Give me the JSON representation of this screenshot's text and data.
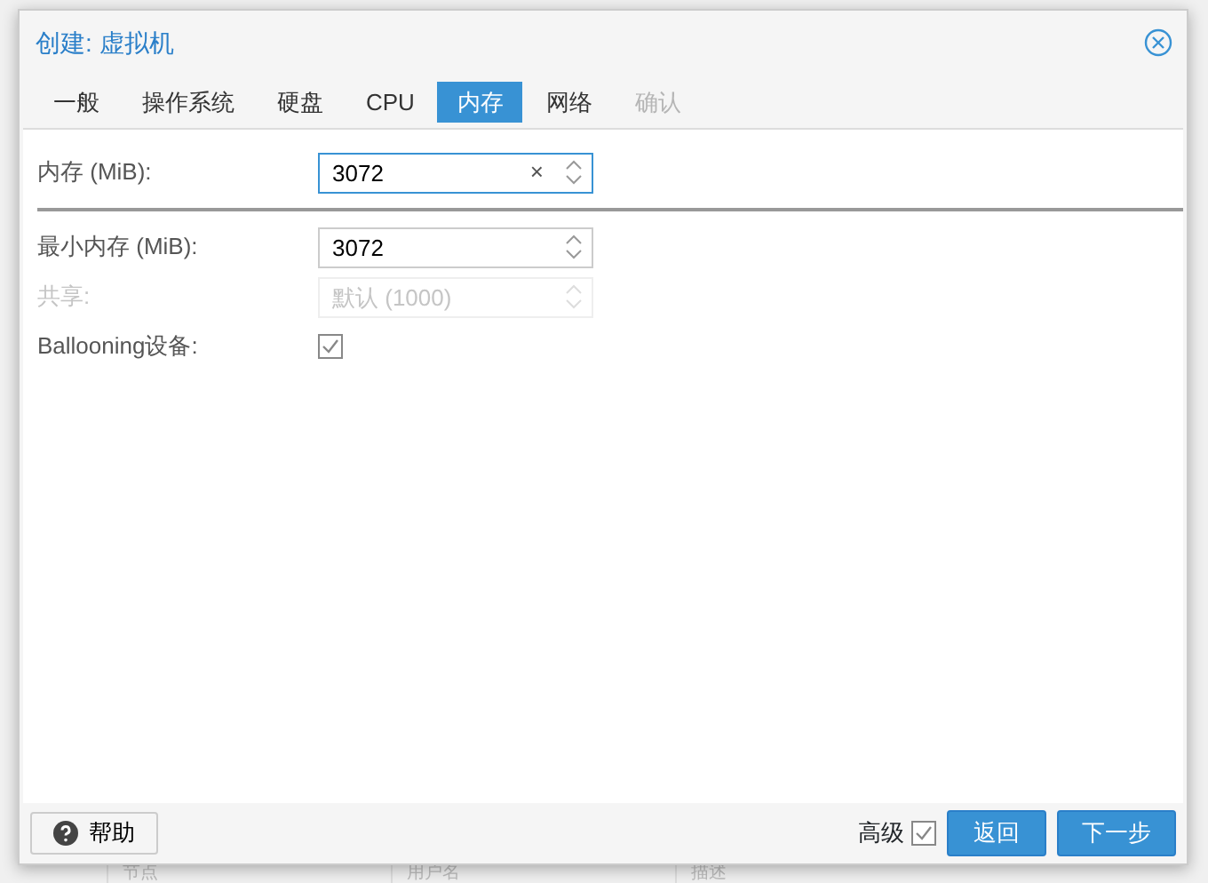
{
  "window": {
    "title": "创建: 虚拟机"
  },
  "tabs": [
    {
      "label": "一般",
      "selected": false,
      "disabled": false
    },
    {
      "label": "操作系统",
      "selected": false,
      "disabled": false
    },
    {
      "label": "硬盘",
      "selected": false,
      "disabled": false
    },
    {
      "label": "CPU",
      "selected": false,
      "disabled": false
    },
    {
      "label": "内存",
      "selected": true,
      "disabled": false
    },
    {
      "label": "网络",
      "selected": false,
      "disabled": false
    },
    {
      "label": "确认",
      "selected": false,
      "disabled": true
    }
  ],
  "fields": [
    {
      "kind": "spinner",
      "label": "内存 (MiB):",
      "value": "3072",
      "focused": true,
      "clear_glyph": "×",
      "disabled": false,
      "divider_after": true
    },
    {
      "kind": "spinner",
      "label": "最小内存 (MiB):",
      "value": "3072",
      "focused": false,
      "disabled": false,
      "divider_after": false
    },
    {
      "kind": "spinner",
      "label": "共享:",
      "placeholder": "默认 (1000)",
      "focused": false,
      "disabled": true,
      "divider_after": false
    },
    {
      "kind": "checkbox",
      "label": "Ballooning设备:",
      "checked": true,
      "disabled": false,
      "divider_after": false
    }
  ],
  "footer": {
    "help": "帮助",
    "advanced": {
      "label": "高级",
      "checked": true
    },
    "buttons": [
      "返回",
      "下一步"
    ]
  },
  "background_columns": [
    "节点",
    "用户名",
    "描述"
  ]
}
